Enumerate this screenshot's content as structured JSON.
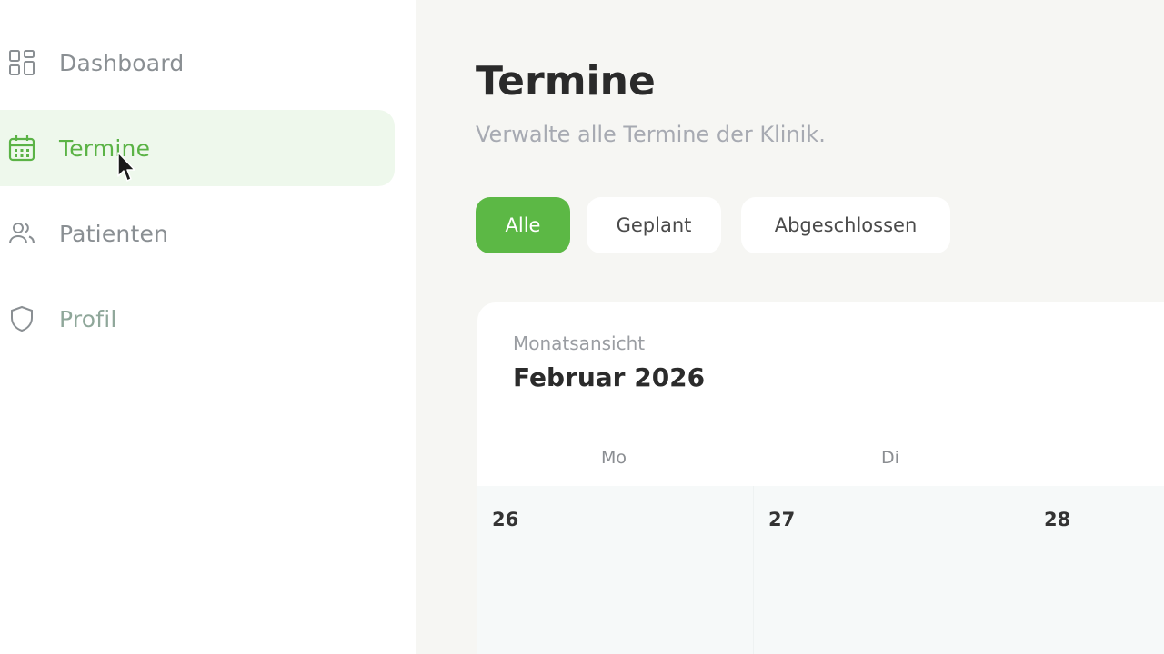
{
  "sidebar": {
    "items": [
      {
        "label": "Dashboard",
        "icon": "grid-icon",
        "active": false
      },
      {
        "label": "Termine",
        "icon": "calendar-icon",
        "active": true
      },
      {
        "label": "Patienten",
        "icon": "users-icon",
        "active": false
      },
      {
        "label": "Profil",
        "icon": "shield-icon",
        "active": false
      }
    ]
  },
  "main": {
    "title": "Termine",
    "subtitle": "Verwalte alle Termine der Klinik.",
    "filters": [
      {
        "label": "Alle",
        "active": true
      },
      {
        "label": "Geplant",
        "active": false
      },
      {
        "label": "Abgeschlossen",
        "active": false
      }
    ],
    "calendar": {
      "view_label": "Monatsansicht",
      "month_label": "Februar 2026",
      "weekdays": [
        "Mo",
        "Di",
        "M"
      ],
      "days": [
        "26",
        "27",
        "28"
      ]
    }
  },
  "colors": {
    "accent": "#5cb845",
    "active_nav_bg": "#eef8ec",
    "main_bg": "#f6f6f3"
  }
}
